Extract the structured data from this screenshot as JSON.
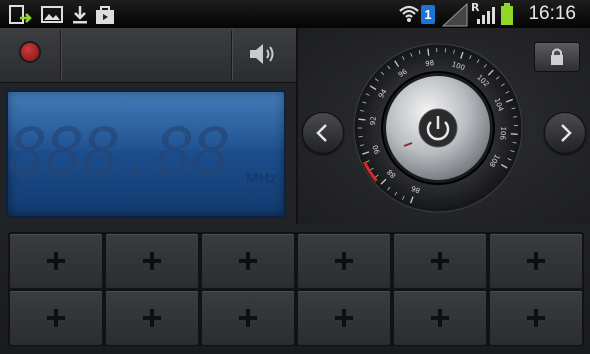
{
  "status_bar": {
    "time": "16:16",
    "sim_badge": "1",
    "roaming": "R",
    "icons": [
      "screen-sync-icon",
      "gallery-icon",
      "download-icon",
      "shopping-bag-icon",
      "wifi-icon",
      "signal-icon",
      "battery-icon"
    ],
    "battery_color": "#8fd629"
  },
  "radio": {
    "frequency_display": "888.88",
    "unit": "MHz",
    "lcd_color": "#1c4f90",
    "accent": "#d62a2a"
  },
  "dial": {
    "scale_labels": [
      "86",
      "88",
      "90",
      "92",
      "94",
      "96",
      "98",
      "100",
      "102",
      "104",
      "106",
      "108"
    ]
  },
  "presets": {
    "rows": 2,
    "cols": 6,
    "icon": "plus-icon"
  }
}
